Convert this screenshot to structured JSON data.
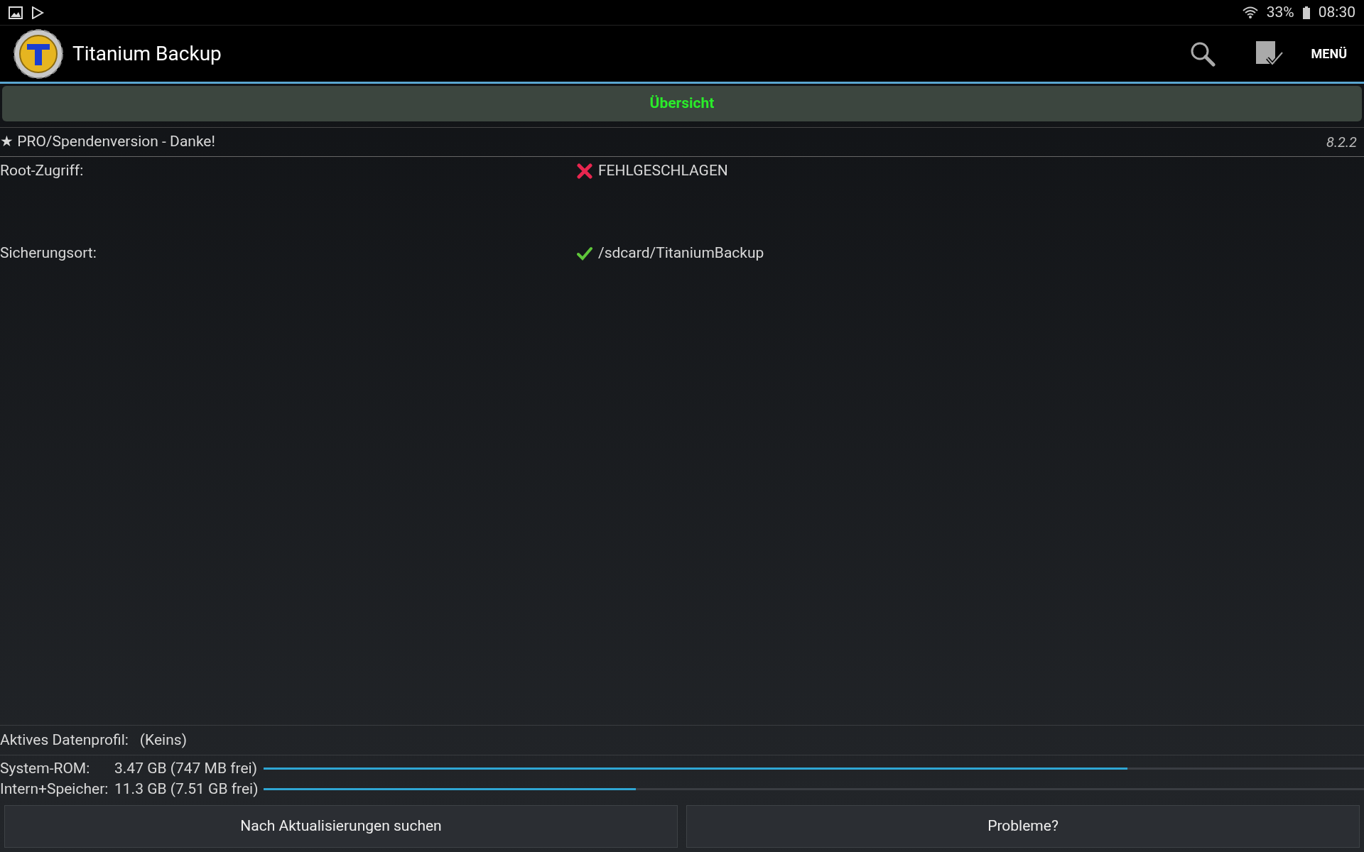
{
  "status_bar": {
    "battery": "33%",
    "time": "08:30"
  },
  "app_bar": {
    "title": "Titanium Backup",
    "menu": "MENÜ"
  },
  "tab": {
    "label": "Übersicht",
    "selected": true
  },
  "version_row": {
    "star": "★",
    "label": "PRO/Spendenversion - Danke!",
    "version": "8.2.2"
  },
  "info_rows": [
    {
      "label": "Root-Zugriff:",
      "kind": "fail",
      "value": "FEHLGESCHLAGEN"
    },
    {
      "label": "Sicherungsort:",
      "kind": "ok",
      "value": "/sdcard/TitaniumBackup"
    }
  ],
  "profile": {
    "label": "Aktives Datenprofil:",
    "value": "(Keins)"
  },
  "storage": [
    {
      "label": "System-ROM:",
      "value": "3.47 GB (747 MB frei)",
      "level": 0.785
    },
    {
      "label": "Intern+Speicher:",
      "value": "11.3 GB (7.51 GB frei)",
      "level": 0.338
    }
  ],
  "buttons": [
    "Nach Aktualisierungen suchen",
    "Probleme?"
  ]
}
